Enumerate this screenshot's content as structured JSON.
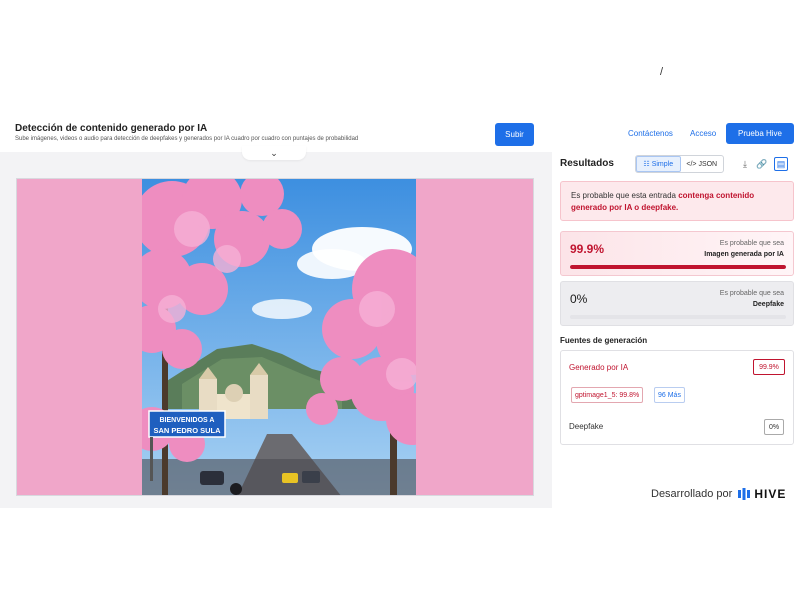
{
  "stray_mark": "/",
  "header": {
    "title": "Detección de contenido generado por IA",
    "subtitle": "Sube imágenes, videos o audio para detección de deepfakes y generados por IA cuadro por cuadro con puntajes de probabilidad",
    "upload_label": "Subir"
  },
  "nav": {
    "contact": "Contáctenos",
    "login": "Acceso",
    "trial": "Prueba Hive"
  },
  "image": {
    "sign_line1": "BIENVENIDOS A",
    "sign_line2": "SAN PEDRO SULA"
  },
  "results": {
    "title": "Resultados",
    "view_simple": "Simple",
    "view_json": "</> JSON",
    "alert_prefix": "Es probable que esta entrada ",
    "alert_highlight": "contenga contenido generado por IA o deepfake.",
    "ai_card": {
      "percent": "99.9%",
      "label1": "Es probable que sea",
      "label2": "Imagen generada por IA",
      "fill": 0.999
    },
    "deepfake_card": {
      "percent": "0%",
      "label1": "Es probable que sea",
      "label2": "Deepfake",
      "fill": 0
    }
  },
  "sources": {
    "title": "Fuentes de generación",
    "ai_label": "Generado por IA",
    "ai_value": "99.9%",
    "model_chip": "gptimage1_5: 99.8%",
    "more_chip": "96 Más",
    "deepfake_label": "Deepfake",
    "deepfake_value": "0%"
  },
  "footer": {
    "powered_by": "Desarrollado por",
    "brand": "HIVE"
  },
  "colors": {
    "accent": "#1e6fe8",
    "danger": "#c0142f",
    "backdrop_pink": "#f0a6c9"
  }
}
